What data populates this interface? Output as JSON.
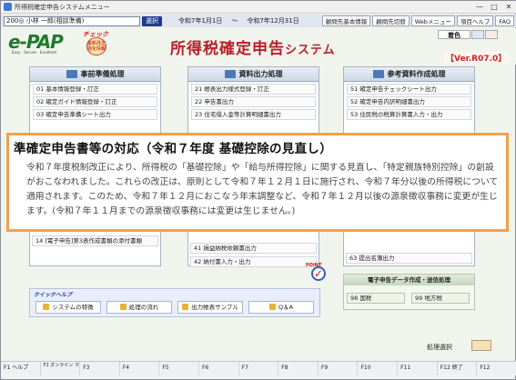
{
  "window": {
    "title": "所得税確定申告システムメニュー",
    "controls": [
      "—",
      "□",
      "✕"
    ]
  },
  "infobar": {
    "user": "200◎ 小林 一郎(相談準備)",
    "change_label": "選択",
    "period_from": "令和7年1月1日",
    "period_sep": "～",
    "period_to": "令和7年12月31日",
    "buttons": [
      "顧問先基本情報",
      "顧問先切替",
      "Webメニュー",
      "項目ヘルプ",
      "FAQ"
    ]
  },
  "header": {
    "logo": "e-PAP",
    "logo_sub": "Easy · Secure · Excellent",
    "badge_top": "チェック",
    "badge_text": "最新改正強化情報",
    "title_main": "所得税確定申告",
    "title_suffix": "システム",
    "color_label": "着色",
    "version": "【Ver.R07.0】"
  },
  "panels": [
    {
      "title": "事前準備処理",
      "items": [
        "01 基本情報登録・訂正",
        "02 確定ガイド情報登録・訂正",
        "03 確定申告準備シート出力"
      ]
    },
    {
      "title": "資料出力処理",
      "items": [
        "21 帳表出力様式登録・訂正",
        "22 申告書出力",
        "23 住宅借入金等計算明細書出力"
      ]
    },
    {
      "title": "参考資料作成処理",
      "items": [
        "51 確定申告チェックシート出力",
        "52 確定申告内訳明細書出力",
        "53 住民税の税算計算書入力・出力"
      ]
    }
  ],
  "lower_items": {
    "p1_partial": "14 [電子申告]第3表作成書類の添付書類",
    "p2_a": "41 損益納税依頼書出力",
    "p2_b": "42 納付書入力・出力",
    "p3_a": "63 提出名簿出力"
  },
  "efile": {
    "title": "電子申告データ作成・送信処理",
    "items": [
      "98 国税",
      "99 地方税"
    ]
  },
  "quick_help": {
    "title": "クイックヘルプ",
    "buttons": [
      "システムの特徴",
      "処理の流れ",
      "出力帳表サンプル",
      "Q＆A"
    ]
  },
  "process_select": "処理選択",
  "fkeys": [
    "F1 ヘルプ",
    "F2 オンライン マニュアル",
    "F3",
    "F4",
    "F5",
    "F6",
    "F7",
    "F8",
    "F9",
    "F10",
    "F11",
    "F12 終了",
    "F12"
  ],
  "notice": {
    "title": "準確定申告書等の対応（令和７年度 基礎控除の見直し）",
    "body": "令和７年度税制改正により、所得税の「基礎控除」や「給与所得控除」に関する見直し、「特定親族特別控除」の創設がおこなわれました。これらの改正は、原則として令和７年１２月１日に施行され、令和７年分以後の所得税について適用されます。このため、令和７年１２月におこなう年末調整など、令和７年１２月以後の源泉徴収事務に変更が生じます。(令和７年１１月までの源泉徴収事務には変更は生じません。)"
  }
}
